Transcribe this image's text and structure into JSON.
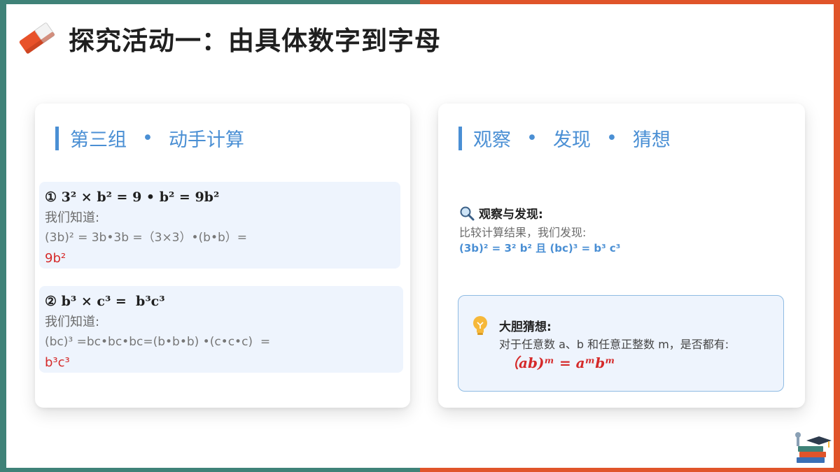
{
  "title": "探究活动一：由具体数字到字母",
  "left_card": {
    "head_part1": "第三组",
    "head_sep": "•",
    "head_part2": "动手计算",
    "calc1": {
      "formula": "① 3² × b² = 9 • b² = 9b²",
      "known": "我们知道:",
      "work": "(3b)² = 3b•3b =（3×3）•(b•b）=",
      "result": "9b²"
    },
    "calc2": {
      "formula": "② b³ × c³ =  b³c³",
      "known": "我们知道:",
      "work": "(bc)³ =bc•bc•bc=(b•b•b) •(c•c•c)  =",
      "result": "b³c³"
    }
  },
  "right_card": {
    "head_part1": "观察",
    "head_sep1": "•",
    "head_part2": "发现",
    "head_sep2": "•",
    "head_part3": "猜想",
    "observe_title": "观察与发现:",
    "observe_text": "比较计算结果，我们发现:",
    "observe_formula": "(3b)² = 3² b² 且 (bc)³ = b³ c³",
    "guess_title": "大胆猜想:",
    "guess_text": "对于任意数 a、b 和任意正整数 m，是否都有:",
    "guess_formula": "（ab)ᵐ = aᵐbᵐ"
  },
  "colors": {
    "accent_blue": "#4a8fd4",
    "result_red": "#d52a2a",
    "frame_green": "#3f8278",
    "frame_orange": "#e0542a"
  }
}
